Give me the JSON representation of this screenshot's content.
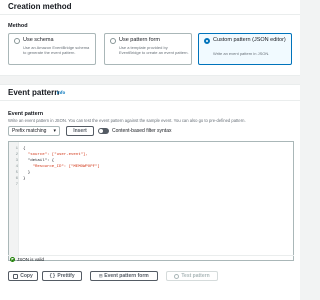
{
  "creation_method": {
    "title": "Creation method",
    "method_label": "Method",
    "options": [
      {
        "title": "Use schema",
        "desc": "Use an Amazon EventBridge schema to generate the event pattern."
      },
      {
        "title": "Use pattern form",
        "desc": "Use a template provided by EventBridge to create an event pattern."
      },
      {
        "title": "Custom pattern (JSON editor)",
        "desc": "Write an event pattern in JSON."
      }
    ],
    "selected_index": 2
  },
  "event_pattern": {
    "title": "Event pattern",
    "info": "Info",
    "field_label": "Event pattern",
    "description": "Write an event pattern in JSON. You can test the event pattern against the sample event. You can also go to pre-defined pattern.",
    "match_select": "Prefix matching",
    "insert_label": "Insert",
    "toggle_label": "Content-based filter syntax",
    "line_numbers": [
      "1",
      "2",
      "3",
      "4",
      "5",
      "6",
      "7"
    ],
    "code_lines": [
      "{",
      "  \"source\": [\"user-event\"],",
      "  \"detail\": {",
      "    \"Resource_ID\": [\"MEMOWPOPF\"]",
      "  }",
      "}",
      ""
    ],
    "status": "JSON is valid",
    "buttons": {
      "copy": "Copy",
      "prettify": "Prettify",
      "pattern_form": "Event pattern form",
      "test": "Test pattern"
    }
  }
}
